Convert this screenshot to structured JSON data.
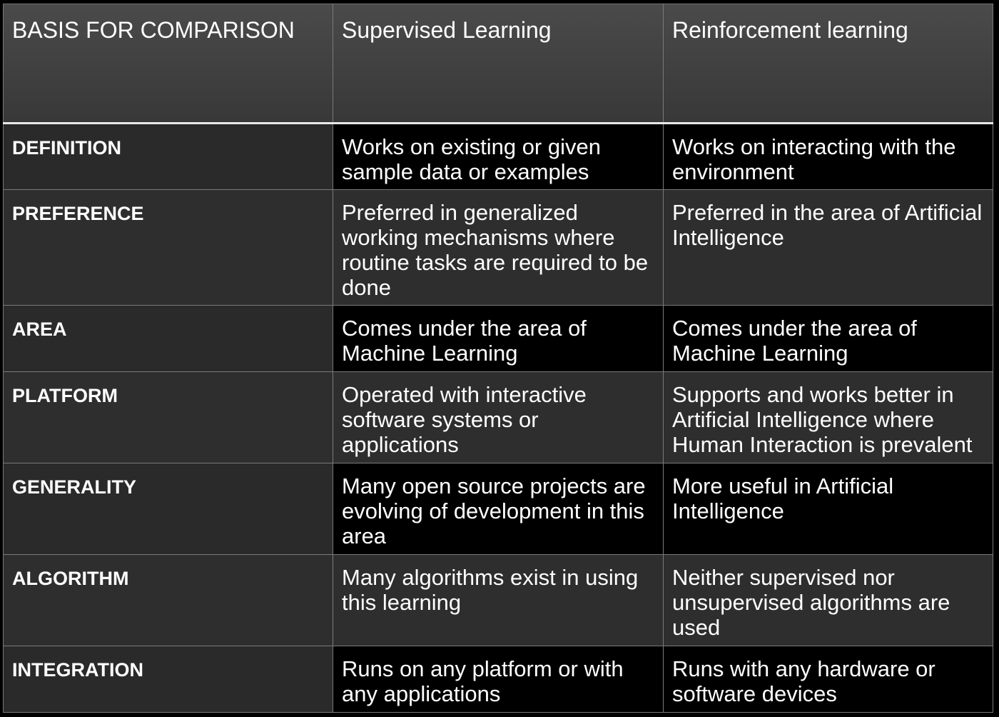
{
  "header": {
    "basis": "BASIS FOR COMPARISON",
    "supervised": "Supervised Learning",
    "reinforcement": "Reinforcement learning"
  },
  "rows": [
    {
      "label": "DEFINITION",
      "supervised": "Works on existing or given sample data or examples",
      "reinforcement": "Works on interacting with the environment"
    },
    {
      "label": "PREFERENCE",
      "supervised": "Preferred in generalized working mechanisms where routine tasks are required to be done",
      "reinforcement": "Preferred in the area of Artificial Intelligence"
    },
    {
      "label": "AREA",
      "supervised": "Comes under the area of Machine Learning",
      "reinforcement": "Comes under the area of Machine Learning"
    },
    {
      "label": "PLATFORM",
      "supervised": "Operated with interactive software systems or applications",
      "reinforcement": "Supports and works better in Artificial Intelligence where Human Interaction is prevalent"
    },
    {
      "label": "GENERALITY",
      "supervised": "Many open source projects are evolving of development in this area",
      "reinforcement": "More useful in Artificial Intelligence"
    },
    {
      "label": "ALGORITHM",
      "supervised": "Many algorithms exist in using this learning",
      "reinforcement": "Neither supervised nor unsupervised algorithms are used"
    },
    {
      "label": "INTEGRATION",
      "supervised": "Runs on any platform or with any applications",
      "reinforcement": "Runs with any hardware or software devices"
    }
  ]
}
